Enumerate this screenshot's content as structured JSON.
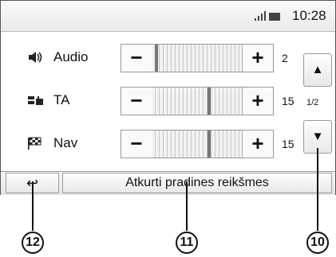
{
  "status_bar": {
    "time": "10:28",
    "icons": [
      "signal-icon",
      "battery-icon"
    ]
  },
  "rows": [
    {
      "label": "Audio",
      "icon": "speaker-icon",
      "value": "2",
      "minus": "−",
      "plus": "+"
    },
    {
      "label": "TA",
      "icon": "traffic-announcement-icon",
      "value": "15",
      "minus": "−",
      "plus": "+"
    },
    {
      "label": "Nav",
      "icon": "checkered-flag-icon",
      "value": "15",
      "minus": "−",
      "plus": "+"
    }
  ],
  "scroll": {
    "up": "▲",
    "down": "▼",
    "page": "1/2"
  },
  "bottom_bar": {
    "back": "↩",
    "reset_label": "Atkurti pradines reikšmes"
  },
  "callouts": [
    "12",
    "11",
    "10"
  ]
}
